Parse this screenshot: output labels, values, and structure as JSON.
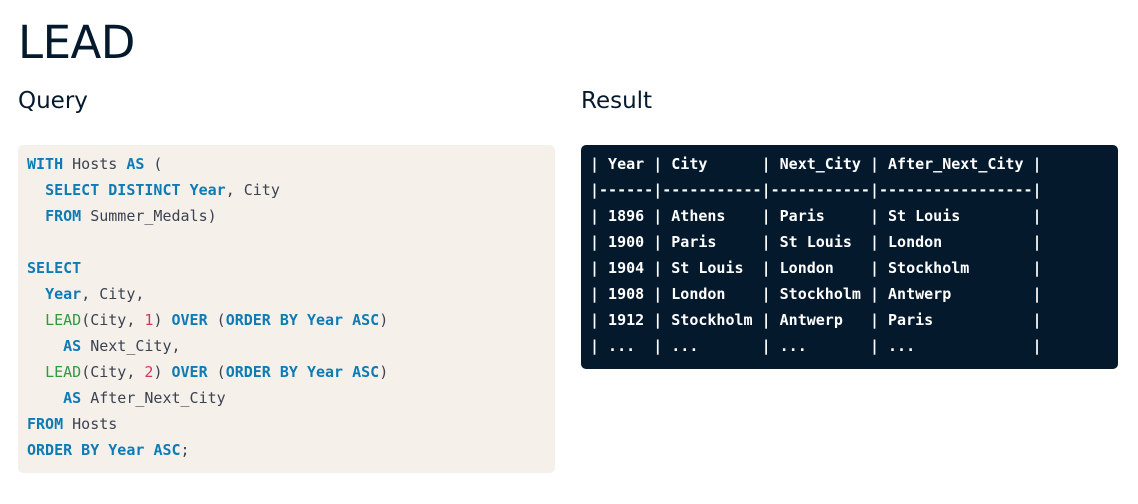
{
  "page": {
    "title": "LEAD"
  },
  "query": {
    "heading": "Query",
    "lines": [
      [
        {
          "t": "WITH",
          "k": "kw"
        },
        {
          "t": " Hosts ",
          "k": "id"
        },
        {
          "t": "AS",
          "k": "kw"
        },
        {
          "t": " (",
          "k": "pun"
        }
      ],
      [
        {
          "t": "  ",
          "k": "id"
        },
        {
          "t": "SELECT DISTINCT",
          "k": "kw"
        },
        {
          "t": " ",
          "k": "id"
        },
        {
          "t": "Year",
          "k": "kw"
        },
        {
          "t": ", City",
          "k": "id"
        }
      ],
      [
        {
          "t": "  ",
          "k": "id"
        },
        {
          "t": "FROM",
          "k": "kw"
        },
        {
          "t": " Summer_Medals)",
          "k": "id"
        }
      ],
      [],
      [
        {
          "t": "SELECT",
          "k": "kw"
        }
      ],
      [
        {
          "t": "  ",
          "k": "id"
        },
        {
          "t": "Year",
          "k": "kw"
        },
        {
          "t": ", City,",
          "k": "id"
        }
      ],
      [
        {
          "t": "  ",
          "k": "id"
        },
        {
          "t": "LEAD",
          "k": "fn"
        },
        {
          "t": "(City, ",
          "k": "id"
        },
        {
          "t": "1",
          "k": "num"
        },
        {
          "t": ") ",
          "k": "id"
        },
        {
          "t": "OVER",
          "k": "kw"
        },
        {
          "t": " (",
          "k": "pun"
        },
        {
          "t": "ORDER BY",
          "k": "kw"
        },
        {
          "t": " ",
          "k": "id"
        },
        {
          "t": "Year",
          "k": "kw"
        },
        {
          "t": " ",
          "k": "id"
        },
        {
          "t": "ASC",
          "k": "kw"
        },
        {
          "t": ")",
          "k": "pun"
        }
      ],
      [
        {
          "t": "    ",
          "k": "id"
        },
        {
          "t": "AS",
          "k": "kw"
        },
        {
          "t": " Next_City,",
          "k": "id"
        }
      ],
      [
        {
          "t": "  ",
          "k": "id"
        },
        {
          "t": "LEAD",
          "k": "fn"
        },
        {
          "t": "(City, ",
          "k": "id"
        },
        {
          "t": "2",
          "k": "num"
        },
        {
          "t": ") ",
          "k": "id"
        },
        {
          "t": "OVER",
          "k": "kw"
        },
        {
          "t": " (",
          "k": "pun"
        },
        {
          "t": "ORDER BY",
          "k": "kw"
        },
        {
          "t": " ",
          "k": "id"
        },
        {
          "t": "Year",
          "k": "kw"
        },
        {
          "t": " ",
          "k": "id"
        },
        {
          "t": "ASC",
          "k": "kw"
        },
        {
          "t": ")",
          "k": "pun"
        }
      ],
      [
        {
          "t": "    ",
          "k": "id"
        },
        {
          "t": "AS",
          "k": "kw"
        },
        {
          "t": " After_Next_City",
          "k": "id"
        }
      ],
      [
        {
          "t": "FROM",
          "k": "kw"
        },
        {
          "t": " Hosts",
          "k": "id"
        }
      ],
      [
        {
          "t": "ORDER BY",
          "k": "kw"
        },
        {
          "t": " ",
          "k": "id"
        },
        {
          "t": "Year",
          "k": "kw"
        },
        {
          "t": " ",
          "k": "id"
        },
        {
          "t": "ASC",
          "k": "kw"
        },
        {
          "t": ";",
          "k": "pun"
        }
      ]
    ]
  },
  "result": {
    "heading": "Result",
    "lines": [
      "| Year | City      | Next_City | After_Next_City |",
      "|------|-----------|-----------|-----------------|",
      "| 1896 | Athens    | Paris     | St Louis        |",
      "| 1900 | Paris     | St Louis  | London          |",
      "| 1904 | St Louis  | London    | Stockholm       |",
      "| 1908 | London    | Stockholm | Antwerp         |",
      "| 1912 | Stockholm | Antwerp   | Paris           |",
      "| ...  | ...       | ...       | ...             |"
    ]
  }
}
